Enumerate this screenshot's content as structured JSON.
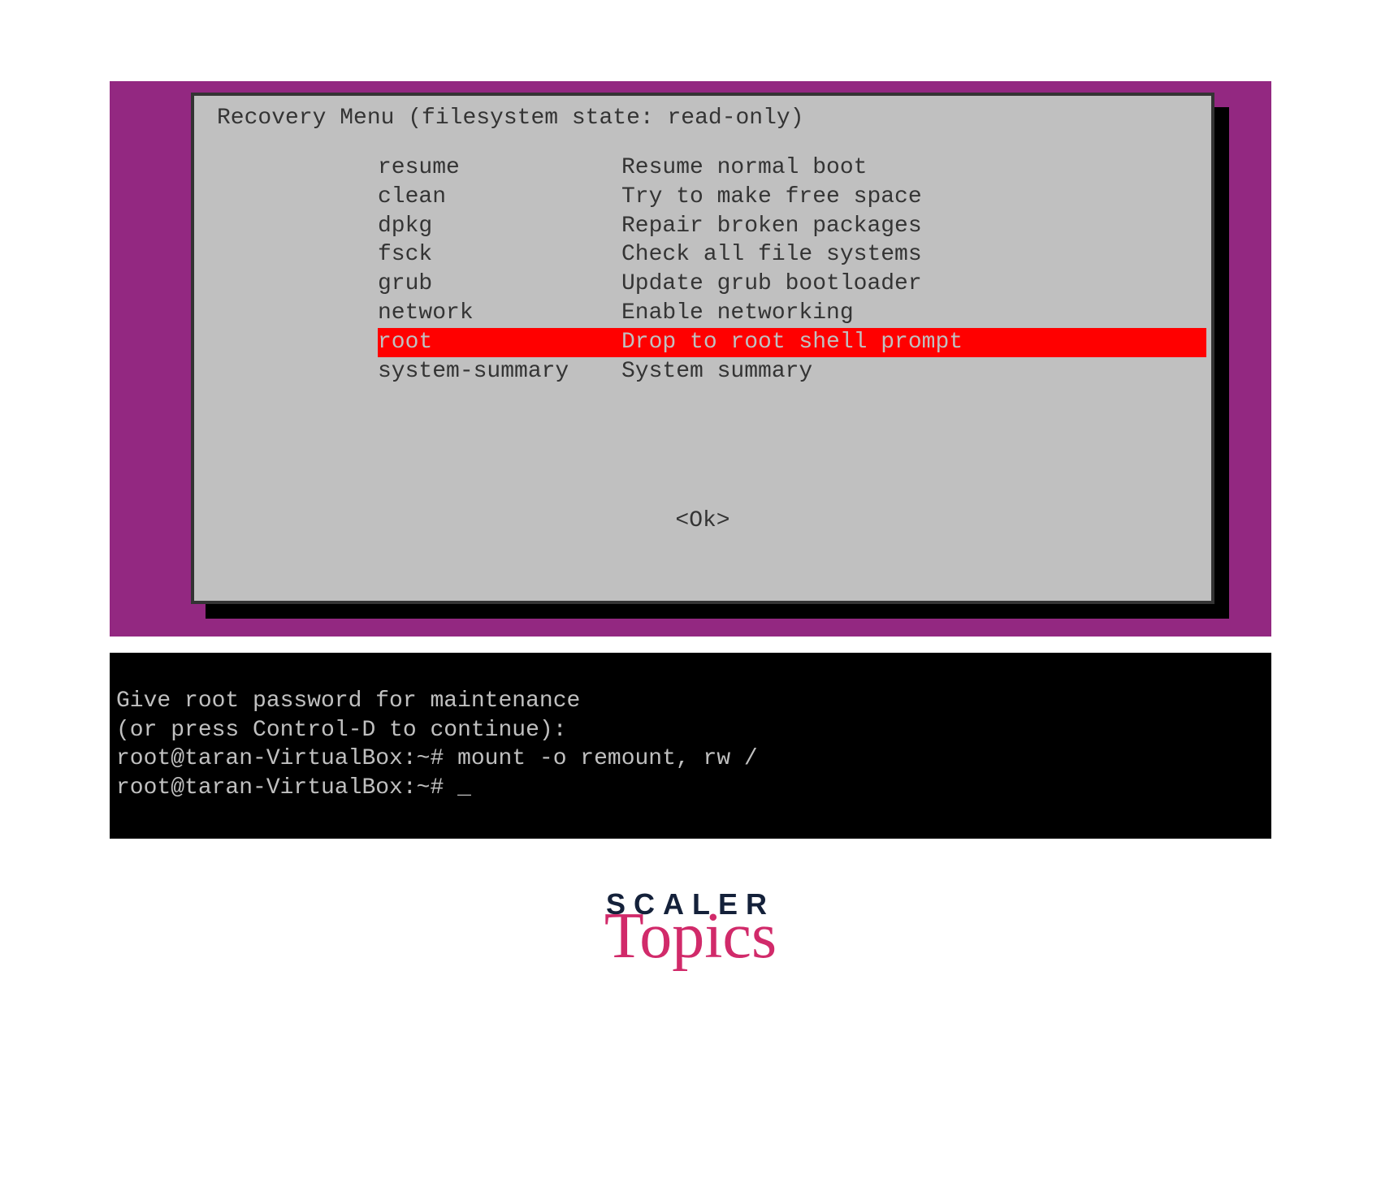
{
  "menu": {
    "title": "Recovery Menu (filesystem state: read-only)",
    "items": [
      {
        "key": "resume",
        "label": "Resume normal boot",
        "selected": false
      },
      {
        "key": "clean",
        "label": "Try to make free space",
        "selected": false
      },
      {
        "key": "dpkg",
        "label": "Repair broken packages",
        "selected": false
      },
      {
        "key": "fsck",
        "label": "Check all file systems",
        "selected": false
      },
      {
        "key": "grub",
        "label": "Update grub bootloader",
        "selected": false
      },
      {
        "key": "network",
        "label": "Enable networking",
        "selected": false
      },
      {
        "key": "root",
        "label": "Drop to root shell prompt",
        "selected": true
      },
      {
        "key": "system-summary",
        "label": "System summary",
        "selected": false
      }
    ],
    "ok_label": "<Ok>"
  },
  "terminal": {
    "lines": [
      "Give root password for maintenance",
      "(or press Control-D to continue):",
      "root@taran-VirtualBox:~# mount -o remount, rw /",
      "root@taran-VirtualBox:~# _"
    ]
  },
  "branding": {
    "line1": "SCALER",
    "line2": "Topics"
  },
  "colors": {
    "purple": "#932881",
    "menu_bg": "#c0c0c0",
    "highlight": "#ff0000",
    "terminal_bg": "#000000",
    "terminal_fg": "#c0c0c0"
  }
}
